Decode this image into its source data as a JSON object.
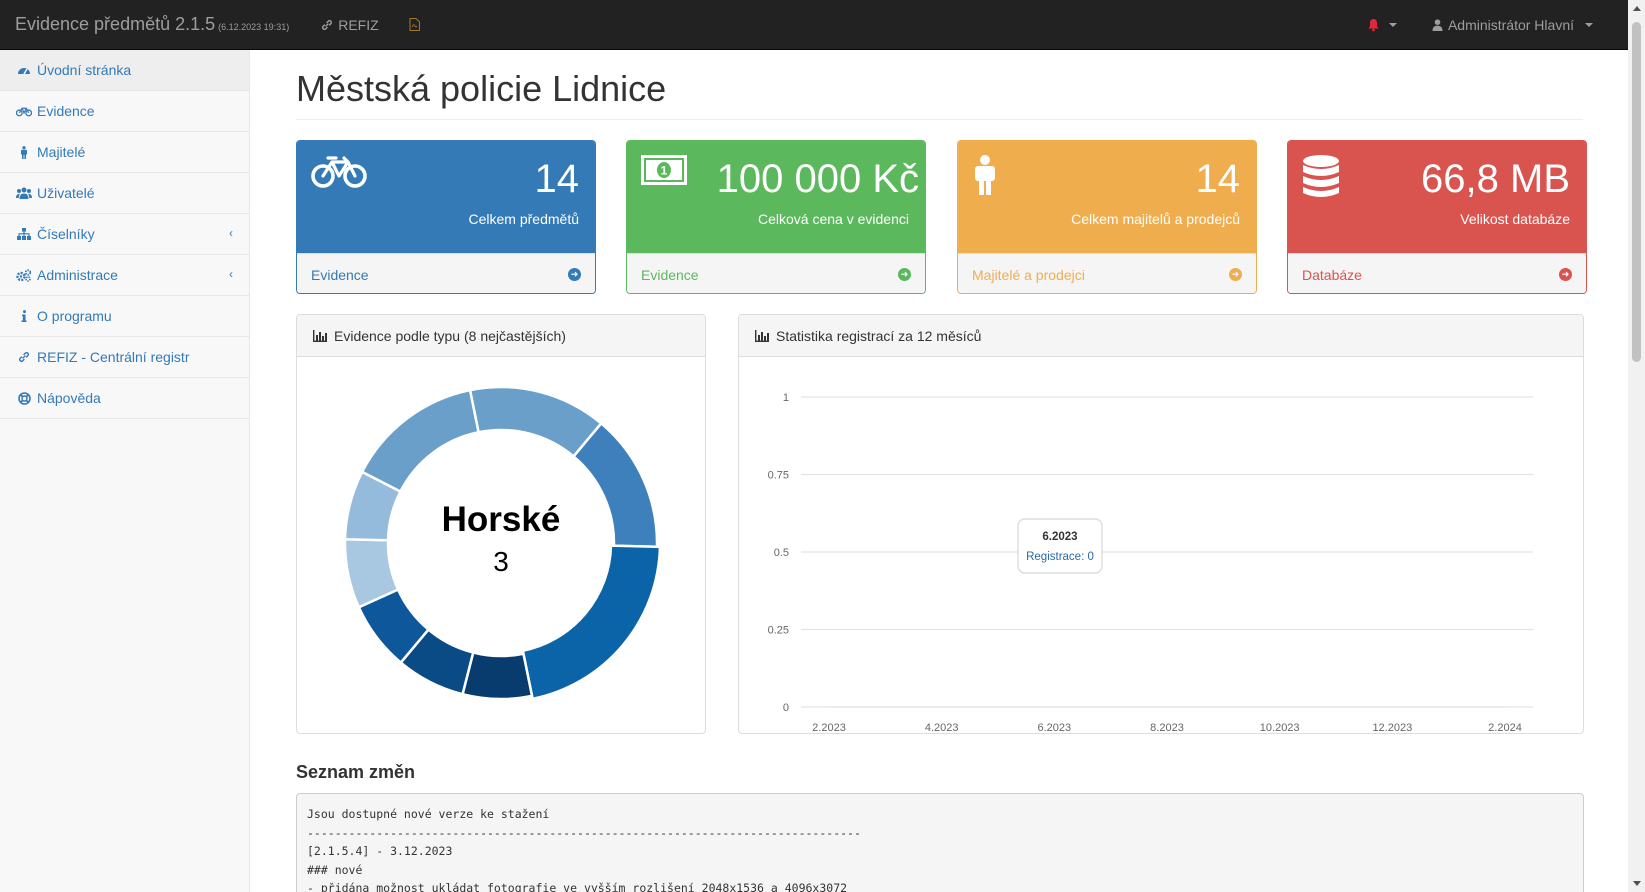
{
  "navbar": {
    "brand": "Evidence předmětů 2.1.5",
    "version_date": "(6.12.2023 19:31)",
    "refiz_link": "REFIZ",
    "user_name": "Administrátor Hlavní"
  },
  "sidebar": {
    "items": [
      {
        "label": "Úvodní stránka",
        "icon": "dashboard-icon"
      },
      {
        "label": "Evidence",
        "icon": "bicycle-icon"
      },
      {
        "label": "Majitelé",
        "icon": "male-icon"
      },
      {
        "label": "Uživatelé",
        "icon": "users-icon"
      },
      {
        "label": "Číselníky",
        "icon": "sitemap-icon"
      },
      {
        "label": "Administrace",
        "icon": "cogs-icon"
      },
      {
        "label": "O programu",
        "icon": "info-icon"
      },
      {
        "label": "REFIZ - Centrální registr",
        "icon": "link-icon"
      },
      {
        "label": "Nápověda",
        "icon": "lifebuoy-icon"
      }
    ]
  },
  "page": {
    "title": "Městská policie Lidnice"
  },
  "cards": [
    {
      "value": "14",
      "subtitle": "Celkem předmětů",
      "link": "Evidence",
      "color": "#337ab7",
      "icon": "bicycle-icon"
    },
    {
      "value": "100 000 Kč",
      "subtitle": "Celková cena v evidenci",
      "link": "Evidence",
      "color": "#5cb85c",
      "icon": "money-icon"
    },
    {
      "value": "14",
      "subtitle": "Celkem majitelů a prodejců",
      "link": "Majitelé a prodejci",
      "color": "#f0ad4e",
      "icon": "male-icon"
    },
    {
      "value": "66,8 MB",
      "subtitle": "Velikost databáze",
      "link": "Databáze",
      "color": "#d9534f",
      "icon": "database-icon"
    }
  ],
  "donut_panel": {
    "title": "Evidence podle typu (8 nejčastějších)",
    "center_label": "Horské",
    "center_value": "3"
  },
  "line_panel": {
    "title": "Statistika registrací za 12 měsíců",
    "tooltip_title": "6.2023",
    "tooltip_label": "Registrace: 0"
  },
  "chart_data": [
    {
      "type": "pie",
      "categories": [
        "",
        "",
        "",
        "",
        "",
        "",
        "",
        "",
        ""
      ],
      "values": [
        2,
        2,
        3,
        1,
        1,
        1,
        1,
        1,
        2
      ],
      "colors": [
        "#6a9fca",
        "#3d80bc",
        "#0b63a8",
        "#083c6e",
        "#0a4b85",
        "#0d579a",
        "#a8c8e2",
        "#94bbdb",
        "#6a9fca"
      ],
      "highlighted": "Horské"
    },
    {
      "type": "line",
      "x": [
        "2.2023",
        "3.2023",
        "4.2023",
        "5.2023",
        "6.2023",
        "7.2023",
        "8.2023",
        "9.2023",
        "10.2023",
        "11.2023",
        "12.2023",
        "1.2024",
        "2.2024"
      ],
      "x_tick_labels": [
        "2.2023",
        "4.2023",
        "6.2023",
        "8.2023",
        "10.2023",
        "12.2023",
        "2.2024"
      ],
      "series": [
        {
          "name": "Registrace",
          "values": [
            0,
            0,
            0,
            0,
            0,
            0,
            0,
            0,
            0,
            0,
            0,
            0,
            0
          ]
        }
      ],
      "ylim": [
        0,
        1
      ],
      "y_ticks": [
        "0",
        "0.25",
        "0.5",
        "0.75",
        "1"
      ],
      "grid": true
    }
  ],
  "changes": {
    "title": "Seznam změn",
    "lines": [
      "Jsou dostupné nové verze ke stažení",
      "--------------------------------------------------------------------------------",
      "[2.1.5.4] - 3.12.2023",
      "### nové",
      "- přidána možnost ukládat fotografie ve vyšším rozlišení 2048x1536 a 4096x3072"
    ]
  }
}
